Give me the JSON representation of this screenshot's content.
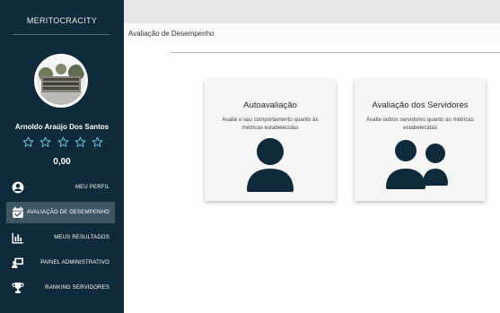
{
  "app": {
    "brand": "MERITOCRACITY"
  },
  "user": {
    "name": "Arnoldo Araújo Dos Santos",
    "rating_stars": 5,
    "score": "0,00"
  },
  "sidebar": {
    "items": [
      {
        "label": "MEU PERFIL",
        "icon": "user-circle-icon",
        "active": false
      },
      {
        "label": "AVALIAÇÃO DE DESEMPENHO",
        "icon": "calendar-check-icon",
        "active": true
      },
      {
        "label": "MEUS RESULTADOS",
        "icon": "bar-chart-icon",
        "active": false
      },
      {
        "label": "PAINEL ADMINISTRATIVO",
        "icon": "admin-panel-icon",
        "active": false
      },
      {
        "label": "RANKING SERVIDORES",
        "icon": "trophy-icon",
        "active": false
      }
    ]
  },
  "header": {
    "breadcrumb": "Avaliação de Desempenho"
  },
  "cards": [
    {
      "title": "Autoavaliação",
      "description": "Avalie o seu comportamento quanto às métricas estabelecidas",
      "icon": "user-icon"
    },
    {
      "title": "Avaliação dos Servidores",
      "description": "Avalie outros servidores quanto às métricas estabelecidas",
      "icon": "users-icon"
    }
  ],
  "colors": {
    "sidebar_bg": "#0f2a3a",
    "active_item_bg": "#3e5664",
    "icon_dark": "#0f2a3a",
    "star_outline": "#6ec6de"
  }
}
